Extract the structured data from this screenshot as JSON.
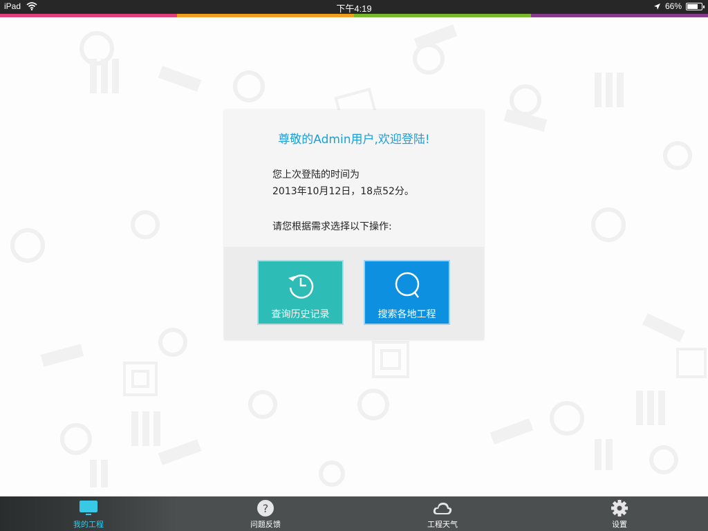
{
  "status_bar": {
    "device": "iPad",
    "time": "下午4:19",
    "battery_percent": "66%",
    "battery_level": 0.66
  },
  "color_strip": [
    "#e0407a",
    "#f0a020",
    "#7ab830",
    "#8a3a8a"
  ],
  "card": {
    "greeting": "尊敬的Admin用户,欢迎登陆!",
    "last_login_label": "您上次登陆的时间为",
    "last_login_time": "2013年10月12日，18点52分。",
    "prompt": "请您根据需求选择以下操作:",
    "buttons": {
      "history": {
        "label": "查询历史记录",
        "icon": "history-clock-icon",
        "color": "#2dbcb6"
      },
      "search": {
        "label": "搜索各地工程",
        "icon": "search-icon",
        "color": "#0d90e0"
      }
    }
  },
  "tab_bar": {
    "active_color": "#37c9e6",
    "tabs": [
      {
        "label": "我的工程",
        "icon": "monitor-icon",
        "active": true
      },
      {
        "label": "问题反馈",
        "icon": "question-icon",
        "active": false
      },
      {
        "label": "工程天气",
        "icon": "cloud-icon",
        "active": false
      },
      {
        "label": "设置",
        "icon": "gear-icon",
        "active": false
      }
    ]
  }
}
